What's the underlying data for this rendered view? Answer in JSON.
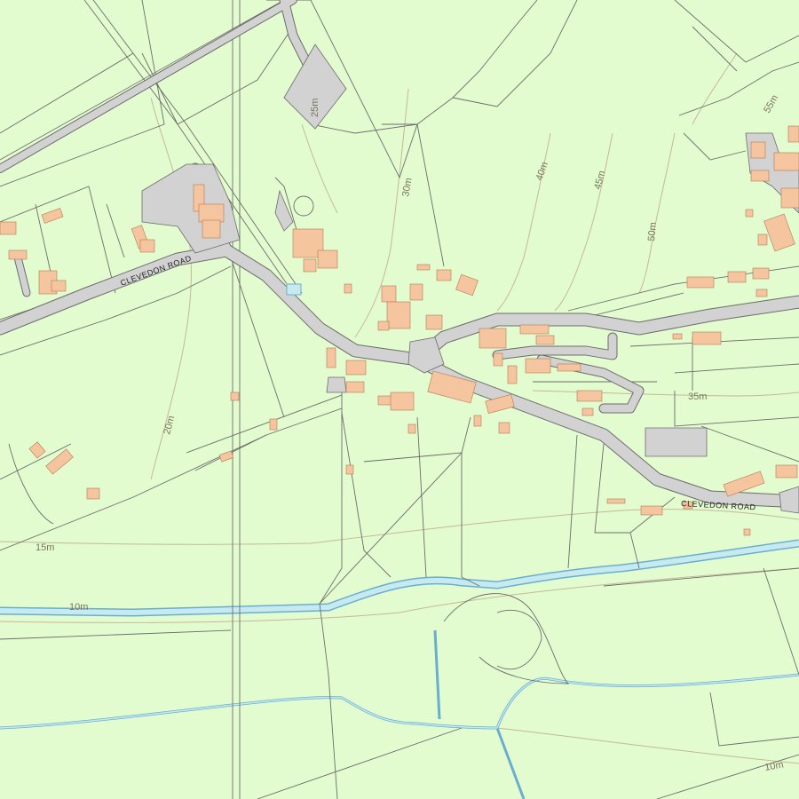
{
  "map": {
    "colors": {
      "land": "#e3fccf",
      "road": "#d2d2d2",
      "building": "#f5c59f",
      "water": "#c6eaf0",
      "water_edge": "#6aaecf",
      "boundary": "#6c6c6c",
      "contour": "#c6b898"
    },
    "road_names": [
      {
        "text": "CLEVEDON ROAD"
      },
      {
        "text": "CLEVEDON ROAD"
      }
    ],
    "contours": [
      {
        "text": "25m"
      },
      {
        "text": "30m"
      },
      {
        "text": "40m"
      },
      {
        "text": "45m"
      },
      {
        "text": "50m"
      },
      {
        "text": "55m"
      },
      {
        "text": "35m"
      },
      {
        "text": "20m"
      },
      {
        "text": "15m"
      },
      {
        "text": "10m"
      },
      {
        "text": "10m"
      }
    ]
  }
}
